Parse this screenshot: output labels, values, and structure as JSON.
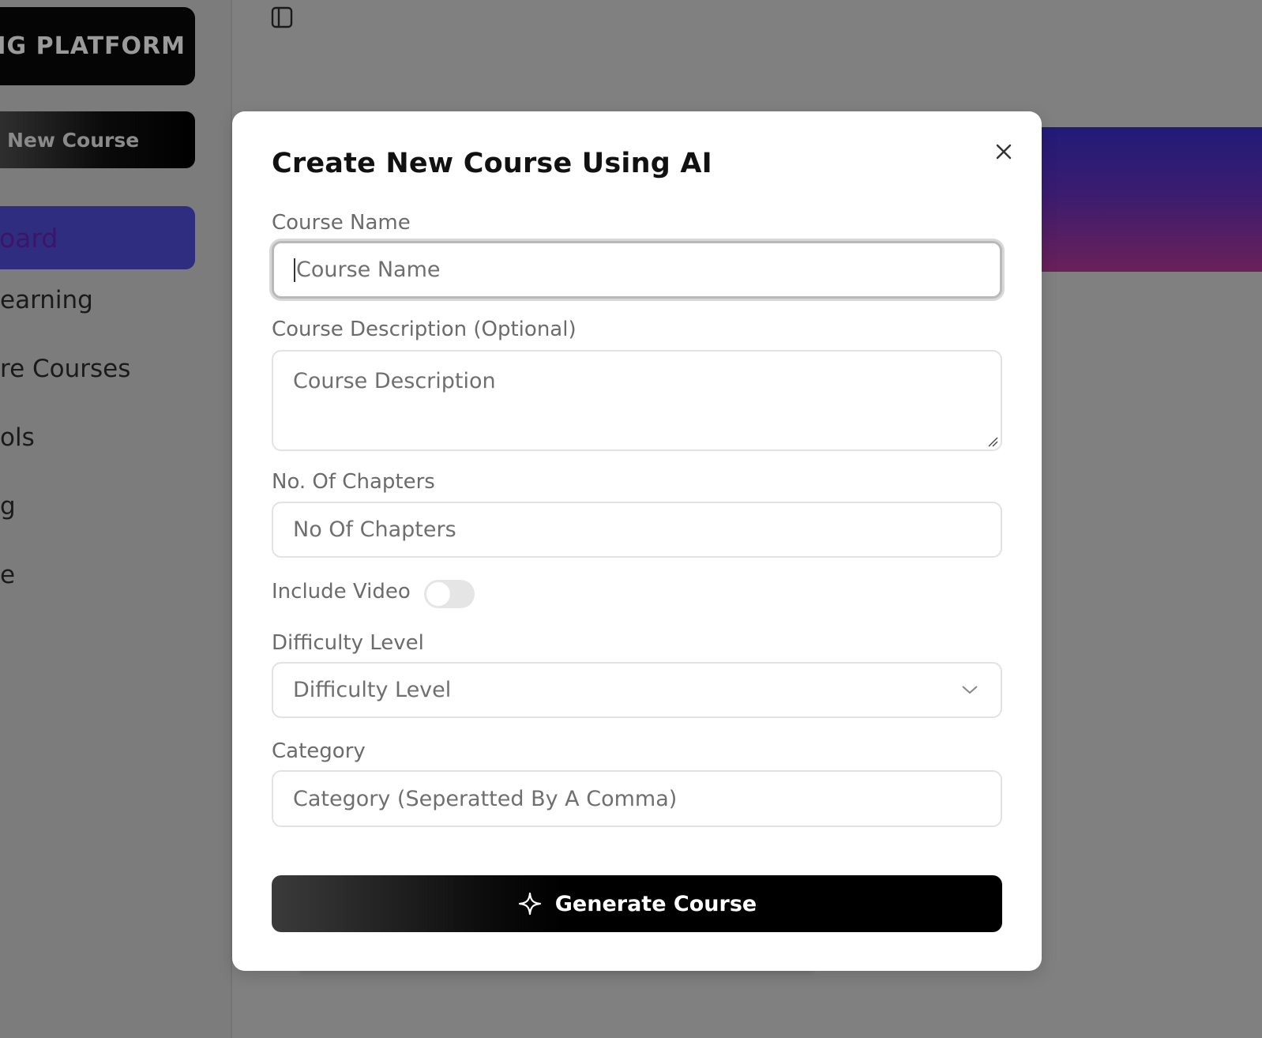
{
  "sidebar": {
    "logo_text": "ARNING PLATFORM",
    "new_course_label": "New Course",
    "items": [
      {
        "label": "board",
        "active": true
      },
      {
        "label": "earning"
      },
      {
        "label": "re Courses"
      },
      {
        "label": "ols"
      },
      {
        "label": "g"
      },
      {
        "label": "e"
      }
    ]
  },
  "modal": {
    "title": "Create New Course Using AI",
    "course_name": {
      "label": "Course Name",
      "placeholder": "Course Name",
      "value": ""
    },
    "description": {
      "label": "Course Description (Optional)",
      "placeholder": "Course Description",
      "value": ""
    },
    "chapters": {
      "label": "No. Of Chapters",
      "placeholder": "No Of Chapters",
      "value": ""
    },
    "include_video": {
      "label": "Include Video",
      "enabled": false
    },
    "difficulty": {
      "label": "Difficulty Level",
      "placeholder": "Difficulty Level"
    },
    "category": {
      "label": "Category",
      "placeholder": "Category (Seperatted By A Comma)",
      "value": ""
    },
    "submit_label": "Generate Course"
  },
  "icons": {
    "close": "close-icon",
    "sparkle": "sparkle-icon",
    "chevron": "chevron-down-icon",
    "sidebar_toggle": "sidebar-toggle-icon"
  },
  "colors": {
    "overlay": "#808080",
    "active_nav": "#2e2d80",
    "banner_top": "#221b78",
    "banner_bottom": "#6b2059",
    "button": "#000000"
  }
}
